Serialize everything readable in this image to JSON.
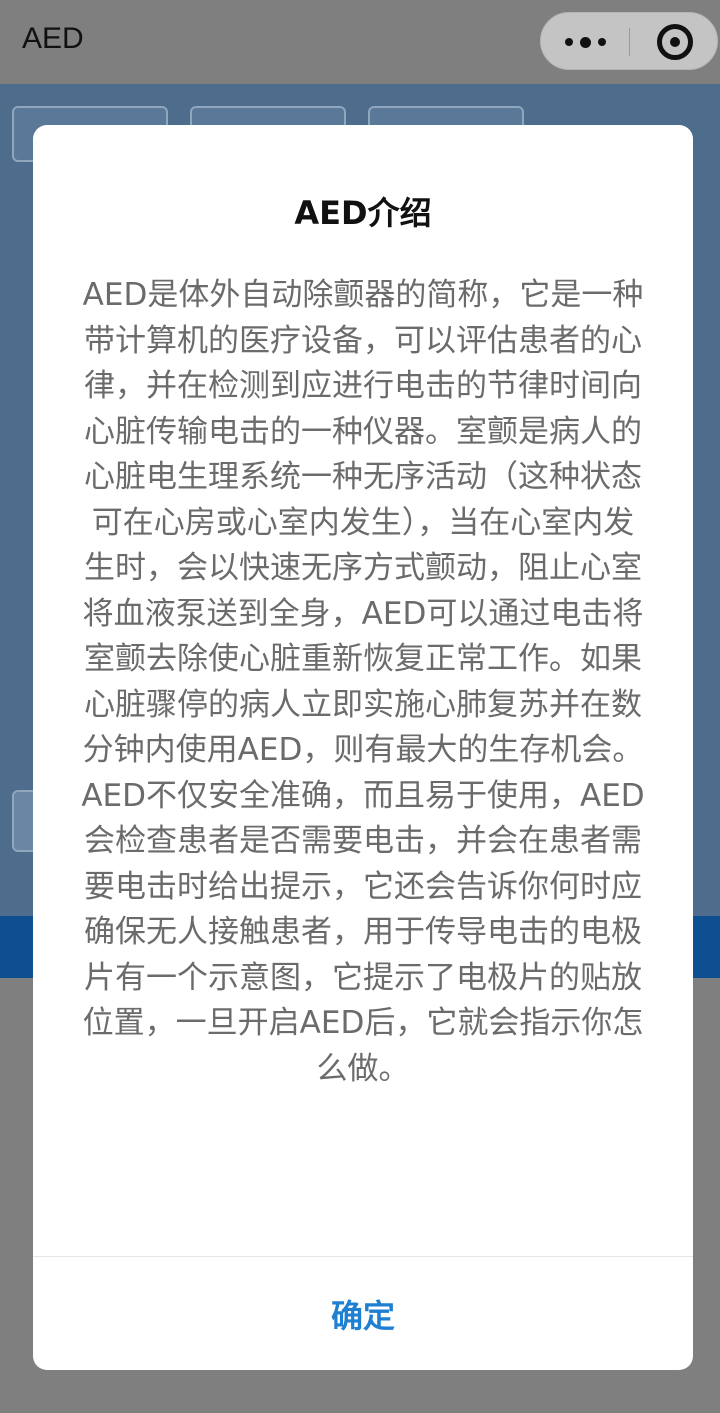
{
  "navbar": {
    "title": "AED",
    "more_icon": "more-dots-icon",
    "close_icon": "close-target-icon"
  },
  "modal": {
    "title": "AED介绍",
    "paragraph_1": "AED是体外自动除颤器的简称，它是一种带计算机的医疗设备，可以评估患者的心律，并在检测到应进行电击的节律时间向心脏传输电击的一种仪器。室颤是病人的心脏电生理系统一种无序活动（这种状态可在心房或心室内发生），当在心室内发生时，会以快速无序方式颤动，阻止心室将血液泵送到全身，AED可以通过电击将室颤去除使心脏重新恢复正常工作。如果心脏骤停的病人立即实施心肺复苏并在数分钟内使用AED，则有最大的生存机会。",
    "paragraph_2": "AED不仅安全准确，而且易于使用，AED会检查患者是否需要电击，并会在患者需要电击时给出提示，它还会告诉你何时应确保无人接触患者，用于传导电击的电极片有一个示意图，它提示了电极片的贴放位置，一旦开启AED后，它就会指示你怎么做。",
    "confirm_label": "确定"
  },
  "colors": {
    "confirm": "#1f7fd1",
    "overlay": "#7f7f7f",
    "background_page": "#4e6c8c",
    "bottom_strip": "#0d4f90"
  }
}
